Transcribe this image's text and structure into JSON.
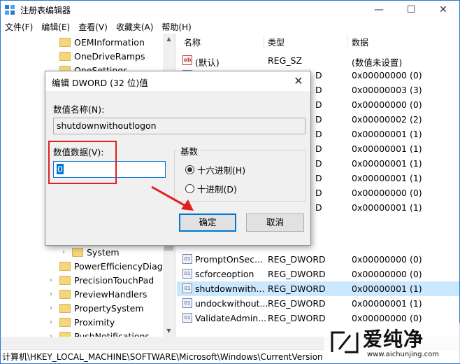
{
  "window": {
    "title": "注册表编辑器",
    "min": "—",
    "max": "☐",
    "close": "✕"
  },
  "menu": [
    "文件(F)",
    "编辑(E)",
    "查看(V)",
    "收藏夹(A)",
    "帮助(H)"
  ],
  "tree": {
    "items": [
      {
        "label": "OEMInformation"
      },
      {
        "label": "OneDriveRamps"
      },
      {
        "label": "OneSettings"
      },
      {
        "label": "System"
      },
      {
        "label": "PowerEfficiencyDiagno"
      },
      {
        "label": "PrecisionTouchPad"
      },
      {
        "label": "PreviewHandlers"
      },
      {
        "label": "PropertySystem"
      },
      {
        "label": "Proximity"
      },
      {
        "label": "PushNotifications"
      }
    ]
  },
  "list": {
    "columns": {
      "name": "名称",
      "type": "类型",
      "data": "数据"
    },
    "rows": [
      {
        "name": "(默认)",
        "type": "REG_SZ",
        "data": "(数值未设置)",
        "icon": "string"
      },
      {
        "name": "",
        "type": "D",
        "data": "0x00000000 (0)",
        "icon": "dword"
      },
      {
        "name": "",
        "type": "D",
        "data": "0x00000003 (3)",
        "icon": "dword"
      },
      {
        "name": "",
        "type": "D",
        "data": "0x00000000 (0)",
        "icon": "dword"
      },
      {
        "name": "",
        "type": "D",
        "data": "0x00000002 (2)",
        "icon": "dword"
      },
      {
        "name": "",
        "type": "D",
        "data": "0x00000001 (1)",
        "icon": "dword"
      },
      {
        "name": "",
        "type": "D",
        "data": "0x00000001 (1)",
        "icon": "dword"
      },
      {
        "name": "",
        "type": "D",
        "data": "0x00000001 (1)",
        "icon": "dword"
      },
      {
        "name": "",
        "type": "D",
        "data": "0x00000001 (1)",
        "icon": "dword"
      },
      {
        "name": "",
        "type": "D",
        "data": "0x00000000 (0)",
        "icon": "dword"
      },
      {
        "name": "",
        "type": "D",
        "data": "0x00000001 (1)",
        "icon": "dword"
      },
      {
        "name": "PromptOnSec...",
        "type": "REG_DWORD",
        "data": "0x00000000 (0)",
        "icon": "dword"
      },
      {
        "name": "scforceoption",
        "type": "REG_DWORD",
        "data": "0x00000000 (0)",
        "icon": "dword"
      },
      {
        "name": "shutdownwith...",
        "type": "REG_DWORD",
        "data": "0x00000001 (1)",
        "icon": "dword"
      },
      {
        "name": "undockwithout...",
        "type": "REG_DWORD",
        "data": "0x00000001 (1)",
        "icon": "dword"
      },
      {
        "name": "ValidateAdmin...",
        "type": "REG_DWORD",
        "data": "0x00000000 (0)",
        "icon": "dword"
      }
    ]
  },
  "status": "计算机\\HKEY_LOCAL_MACHINE\\SOFTWARE\\Microsoft\\Windows\\CurrentVersion",
  "dialog": {
    "title": "编辑 DWORD (32 位)值",
    "close": "✕",
    "name_label": "数值名称(N):",
    "name_value": "shutdownwithoutlogon",
    "data_label": "数值数据(V):",
    "data_value": "0",
    "base_label": "基数",
    "hex_label": "十六进制(H)",
    "dec_label": "十进制(D)",
    "hex_selected": true,
    "ok_label": "确定",
    "cancel_label": "取消"
  },
  "watermark": {
    "title": "爱纯净",
    "url": "www.aichunjing.com"
  },
  "colors": {
    "accent": "#0078d7",
    "selection": "#cce8ff",
    "annotation": "#e02020"
  }
}
